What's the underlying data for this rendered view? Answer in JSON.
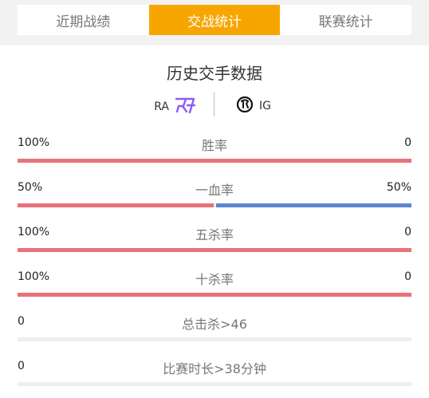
{
  "tabs": [
    {
      "label": "近期战绩",
      "active": false
    },
    {
      "label": "交战统计",
      "active": true
    },
    {
      "label": "联赛统计",
      "active": false
    }
  ],
  "section_title": "历史交手数据",
  "teams": {
    "left": {
      "name": "RA",
      "logo": "ra-logo-icon"
    },
    "right": {
      "name": "IG",
      "logo": "ig-logo-icon"
    }
  },
  "colors": {
    "accent": "#f7a600",
    "left_bar": "#e8727a",
    "right_bar": "#5b86d0",
    "track": "#eeeeee",
    "ra_logo": "#8b5cf6"
  },
  "stats": [
    {
      "label": "胜率",
      "left": "100%",
      "right": "0",
      "left_share": 1.0,
      "right_share": 0.0
    },
    {
      "label": "一血率",
      "left": "50%",
      "right": "50%",
      "left_share": 0.5,
      "right_share": 0.5
    },
    {
      "label": "五杀率",
      "left": "100%",
      "right": "0",
      "left_share": 1.0,
      "right_share": 0.0
    },
    {
      "label": "十杀率",
      "left": "100%",
      "right": "0",
      "left_share": 1.0,
      "right_share": 0.0
    },
    {
      "label": "总击杀>46",
      "left": "0",
      "right": "",
      "left_share": 0.0,
      "right_share": 0.0
    },
    {
      "label": "比赛时长>38分钟",
      "left": "0",
      "right": "",
      "left_share": 0.0,
      "right_share": 0.0
    }
  ]
}
